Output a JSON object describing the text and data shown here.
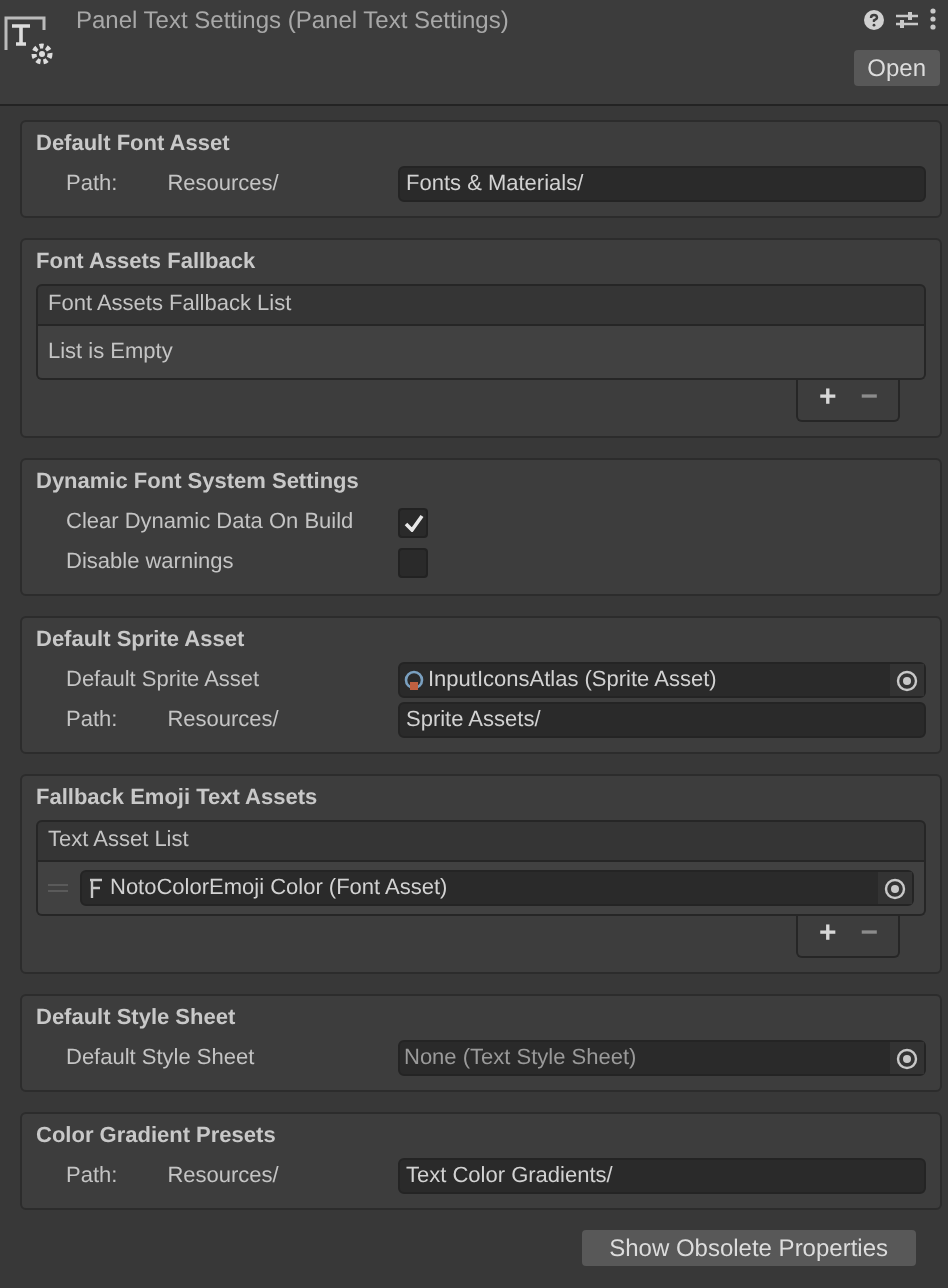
{
  "header": {
    "title": "Panel Text Settings (Panel Text Settings)",
    "open_button": "Open"
  },
  "sections": [
    {
      "title": "Default Font Asset",
      "rows": [
        {
          "kind": "path",
          "label": "Path:",
          "prefix": "Resources/",
          "value": "Fonts & Materials/"
        }
      ]
    },
    {
      "title": "Font Assets Fallback",
      "rows": [
        {
          "kind": "list",
          "header": "Font Assets Fallback List",
          "empty_text": "List is Empty",
          "items": [],
          "add": "+",
          "remove": "−"
        }
      ]
    },
    {
      "title": "Dynamic Font System Settings",
      "rows": [
        {
          "kind": "toggle",
          "label": "Clear Dynamic Data On Build",
          "checked": true
        },
        {
          "kind": "toggle",
          "label": "Disable warnings",
          "checked": false
        }
      ]
    },
    {
      "title": "Default Sprite Asset",
      "rows": [
        {
          "kind": "object",
          "label": "Default Sprite Asset",
          "value": "InputIconsAtlas (Sprite Asset)",
          "assigned": true
        },
        {
          "kind": "path",
          "label": "Path:",
          "prefix": "Resources/",
          "value": "Sprite Assets/"
        }
      ]
    },
    {
      "title": "Fallback Emoji Text Assets",
      "rows": [
        {
          "kind": "list",
          "header": "Text Asset List",
          "items": [
            {
              "value": "NotoColorEmoji Color (Font Asset)"
            }
          ],
          "add": "+",
          "remove": "−"
        }
      ]
    },
    {
      "title": "Default Style Sheet",
      "rows": [
        {
          "kind": "object",
          "label": "Default Style Sheet",
          "value": "None (Text Style Sheet)",
          "assigned": false
        }
      ]
    },
    {
      "title": "Color Gradient Presets",
      "rows": [
        {
          "kind": "path",
          "label": "Path:",
          "prefix": "Resources/",
          "value": "Text Color Gradients/"
        }
      ]
    }
  ],
  "footer_button": "Show Obsolete Properties"
}
